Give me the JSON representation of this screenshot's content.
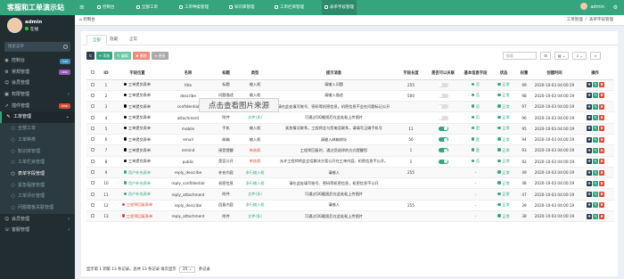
{
  "app": {
    "logo": "客服和工单演示站",
    "user": "admin",
    "status": "在线",
    "search_placeholder": "搜索菜单"
  },
  "sidebar": {
    "items": [
      {
        "label": "控制台",
        "icon": "dashboard-icon",
        "badge": "hot",
        "badge_color": "#3c8dbc"
      },
      {
        "label": "常规管理",
        "icon": "gear-icon",
        "badge": "new",
        "badge_color": "#9b59b6"
      },
      {
        "label": "会员管理",
        "icon": "user-icon",
        "badge": "",
        "badge_color": ""
      },
      {
        "label": "权限管理",
        "icon": "group-icon",
        "badge": "",
        "badge_color": ""
      },
      {
        "label": "插件管理",
        "icon": "rocket-icon",
        "badge": "new",
        "badge_color": "#dd4b39"
      },
      {
        "label": "工单管理",
        "icon": "ticket-icon",
        "badge": "",
        "badge_color": ""
      }
    ],
    "sub_items": [
      "全部工单",
      "工单种类",
      "知识库管理",
      "工单栏目管理",
      "表单字段管理",
      "紧急程度管理",
      "工单评价管理",
      "问题模板关联管理"
    ],
    "bottom_items": [
      {
        "label": "会员管理",
        "icon": "user-icon"
      },
      {
        "label": "客服管理",
        "icon": "headset-icon"
      }
    ]
  },
  "topnav": {
    "items": [
      "控制台",
      "全部工单",
      "工单种类管理",
      "知识库管理",
      "工单栏目管理",
      "表单字段管理"
    ],
    "admin": "admin"
  },
  "breadcrumb": {
    "left": "控制台",
    "right_a": "工单管理",
    "right_b": "表单字段管理"
  },
  "tabs": [
    "全部",
    "隐藏",
    "正常"
  ],
  "toolbar": {
    "add": "添加",
    "edit": "编辑",
    "del": "删除",
    "more": "更多",
    "search_placeholder": "搜索"
  },
  "overlay": "点击查看图片来源",
  "table": {
    "headers": [
      "ID",
      "字段位置",
      "名称",
      "标题",
      "类型",
      "提示消息",
      "字段长度",
      "是否可以关联",
      "基本信息字段",
      "状态",
      "权重",
      "创建时间",
      "操作"
    ],
    "rows": [
      {
        "id": "1",
        "pos": "工单提交表单",
        "pos_color": "#000000",
        "name": "title",
        "title": "标题",
        "type": "输入框",
        "type_color": "#333333",
        "tip": "请输入问题",
        "len": "255",
        "rel": "off",
        "basic": "否",
        "basic_color": "#35a57e",
        "status": "正常",
        "weight": "99",
        "time": "2020-10-03 04:00:19"
      },
      {
        "id": "2",
        "pos": "工单提交表单",
        "pos_color": "#000000",
        "name": "describe",
        "title": "问题描述",
        "type": "输入框",
        "type_color": "#333333",
        "tip": "请输入描述",
        "len": "500",
        "rel": "off",
        "basic": "否",
        "basic_color": "#35a57e",
        "status": "正常",
        "weight": "98",
        "time": "2020-10-03 04:00:19"
      },
      {
        "id": "3",
        "pos": "工单提交表单",
        "pos_color": "#000000",
        "name": "confidential",
        "title": "机密信息",
        "type": "多行输入框",
        "type_color": "#35a57e",
        "tip": "请在此处填写账号、密码等机密信息，机密信息不会在问题标记公开",
        "len": "",
        "rel": "off",
        "basic": "否",
        "basic_color": "#35a57e",
        "status": "正常",
        "weight": "97",
        "time": "2020-10-03 04:00:19"
      },
      {
        "id": "4",
        "pos": "工单提交表单",
        "pos_color": "#000000",
        "name": "attachment",
        "title": "附件",
        "type": "文件(多)",
        "type_color": "#35a57e",
        "tip": "可通过QQ截图后在此处粘上传图片",
        "len": "",
        "rel": "off",
        "basic": "否",
        "basic_color": "#35a57e",
        "status": "正常",
        "weight": "96",
        "time": "2020-10-03 04:00:19"
      },
      {
        "id": "5",
        "pos": "工单提交表单",
        "pos_color": "#000000",
        "name": "mobile",
        "title": "手机",
        "type": "输入框",
        "type_color": "#333333",
        "tip": "紧急情况联系，工程师会与您电话联系，请填写正确手机号",
        "len": "11",
        "rel": "on",
        "basic": "是",
        "basic_color": "#35a57e",
        "status": "正常",
        "weight": "95",
        "time": "2020-10-03 04:00:19"
      },
      {
        "id": "6",
        "pos": "工单提交表单",
        "pos_color": "#000000",
        "name": "email",
        "title": "邮箱",
        "type": "输入框",
        "type_color": "#333333",
        "tip": "请输入邮箱地址",
        "len": "50",
        "rel": "on",
        "basic": "是",
        "basic_color": "#35a57e",
        "status": "正常",
        "weight": "94",
        "time": "2020-10-03 04:00:19"
      },
      {
        "id": "7",
        "pos": "工单提交表单",
        "pos_color": "#000000",
        "name": "remind",
        "title": "接受提醒",
        "type": "单选框",
        "type_color": "#dd4b39",
        "tip": "工程师回复时，通过您选择的方式提醒您",
        "len": "1",
        "rel": "on",
        "basic": "是",
        "basic_color": "#35a57e",
        "status": "正常",
        "weight": "93",
        "time": "2020-10-03 04:00:19"
      },
      {
        "id": "8",
        "pos": "工单提交表单",
        "pos_color": "#000000",
        "name": "public",
        "title": "是否公开",
        "type": "单选框",
        "type_color": "#dd4b39",
        "tip": "允许工程师将此会话解决方案公开在工单内容，机密信息不公开。",
        "len": "1",
        "rel": "on",
        "basic": "否",
        "basic_color": "#35a57e",
        "status": "正常",
        "weight": "92",
        "time": "2020-10-03 04:00:19"
      },
      {
        "id": "9",
        "pos": "用户补充表单",
        "pos_color": "#35a57e",
        "name": "reply_describe",
        "title": "补充内容",
        "type": "多行输入框",
        "type_color": "#35a57e",
        "tip": "请输入",
        "len": "255",
        "rel": "",
        "basic": "-",
        "basic_color": "#333333",
        "status": "正常",
        "weight": "49",
        "time": "2020-10-03 04:00:19"
      },
      {
        "id": "10",
        "pos": "用户补充表单",
        "pos_color": "#35a57e",
        "name": "reply_confidential",
        "title": "机密信息",
        "type": "多行输入框",
        "type_color": "#35a57e",
        "tip": "请在此处填写账号、密码等机密信息，机密信息不公开",
        "len": "",
        "rel": "",
        "basic": "-",
        "basic_color": "#333333",
        "status": "正常",
        "weight": "48",
        "time": "2020-10-03 04:00:19"
      },
      {
        "id": "11",
        "pos": "用户补充表单",
        "pos_color": "#35a57e",
        "name": "reply_attachment",
        "title": "附件",
        "type": "文件(多)",
        "type_color": "#35a57e",
        "tip": "可通过QQ截图后在此处粘上传图片",
        "len": "",
        "rel": "",
        "basic": "-",
        "basic_color": "#333333",
        "status": "正常",
        "weight": "47",
        "time": "2020-10-03 04:00:19"
      },
      {
        "id": "12",
        "pos": "工程师回复表单",
        "pos_color": "#dd4b39",
        "name": "reply_describe",
        "title": "回复内容",
        "type": "多行输入框",
        "type_color": "#35a57e",
        "tip": "请输入",
        "len": "255",
        "rel": "",
        "basic": "-",
        "basic_color": "#333333",
        "status": "正常",
        "weight": "39",
        "time": "2020-10-03 04:00:19"
      },
      {
        "id": "13",
        "pos": "工程师回复表单",
        "pos_color": "#dd4b39",
        "name": "reply_attachment",
        "title": "附件",
        "type": "文件(多)",
        "type_color": "#35a57e",
        "tip": "可通过QQ截图后在此处粘上传图片",
        "len": "",
        "rel": "",
        "basic": "-",
        "basic_color": "#333333",
        "status": "正常",
        "weight": "38",
        "time": "2020-10-03 04:00:19"
      }
    ]
  },
  "footer": {
    "text": "显示第 1 到第 13 条记录，总共 13 条记录 每页显示",
    "page_size": "25",
    "suffix": "条记录"
  },
  "colors": {
    "brand": "#35a57e",
    "danger": "#dd4b39",
    "primary": "#3c8dbc",
    "dark": "#222d32"
  }
}
